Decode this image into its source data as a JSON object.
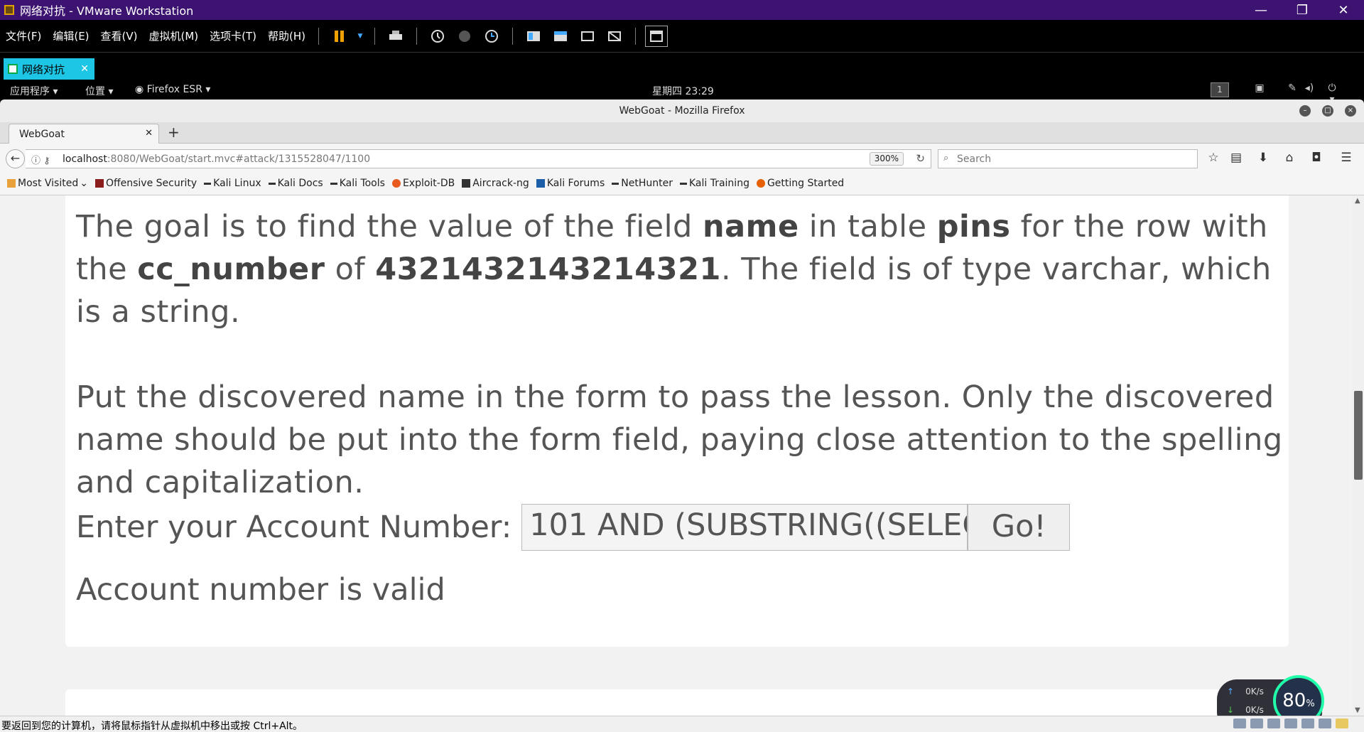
{
  "vmware": {
    "title": "网络对抗 - VMware Workstation",
    "menu": [
      "文件(F)",
      "编辑(E)",
      "查看(V)",
      "虚拟机(M)",
      "选项卡(T)",
      "帮助(H)"
    ],
    "tab_label": "网络对抗",
    "status_text": "要返回到您的计算机，请将鼠标指针从虚拟机中移出或按 Ctrl+Alt。"
  },
  "kali_panel": {
    "apps": "应用程序",
    "places": "位置",
    "browser": "Firefox ESR",
    "clock": "星期四 23:29",
    "workspace": "1"
  },
  "firefox": {
    "window_title": "WebGoat - Mozilla Firefox",
    "tab_title": "WebGoat",
    "url_host": "localhost",
    "url_rest": ":8080/WebGoat/start.mvc#attack/1315528047/1100",
    "zoom": "300%",
    "search_placeholder": "Search",
    "bookmarks": [
      "Most Visited",
      "Offensive Security",
      "Kali Linux",
      "Kali Docs",
      "Kali Tools",
      "Exploit-DB",
      "Aircrack-ng",
      "Kali Forums",
      "NetHunter",
      "Kali Training",
      "Getting Started"
    ]
  },
  "lesson": {
    "p1_a": "The goal is to find the value of the field ",
    "p1_b": "name",
    "p1_c": " in table ",
    "p1_d": "pins",
    "p1_e": " for the row with the ",
    "p1_f": "cc_number",
    "p1_g": " of ",
    "p1_h": "4321432143214321",
    "p1_i": ". The field is of type varchar, which is a string.",
    "p2": "Put the discovered name in the form to pass the lesson. Only the discovered name should be put into the form field, paying close attention to the spelling and capitalization.",
    "account_label": "Enter your Account Number:",
    "account_value": "101 AND (SUBSTRING((SELEC",
    "go_label": "Go!",
    "result": "Account number is valid"
  },
  "net_widget": {
    "up": "0K/s",
    "down": "0K/s",
    "percent": "80",
    "percent_unit": "%"
  }
}
